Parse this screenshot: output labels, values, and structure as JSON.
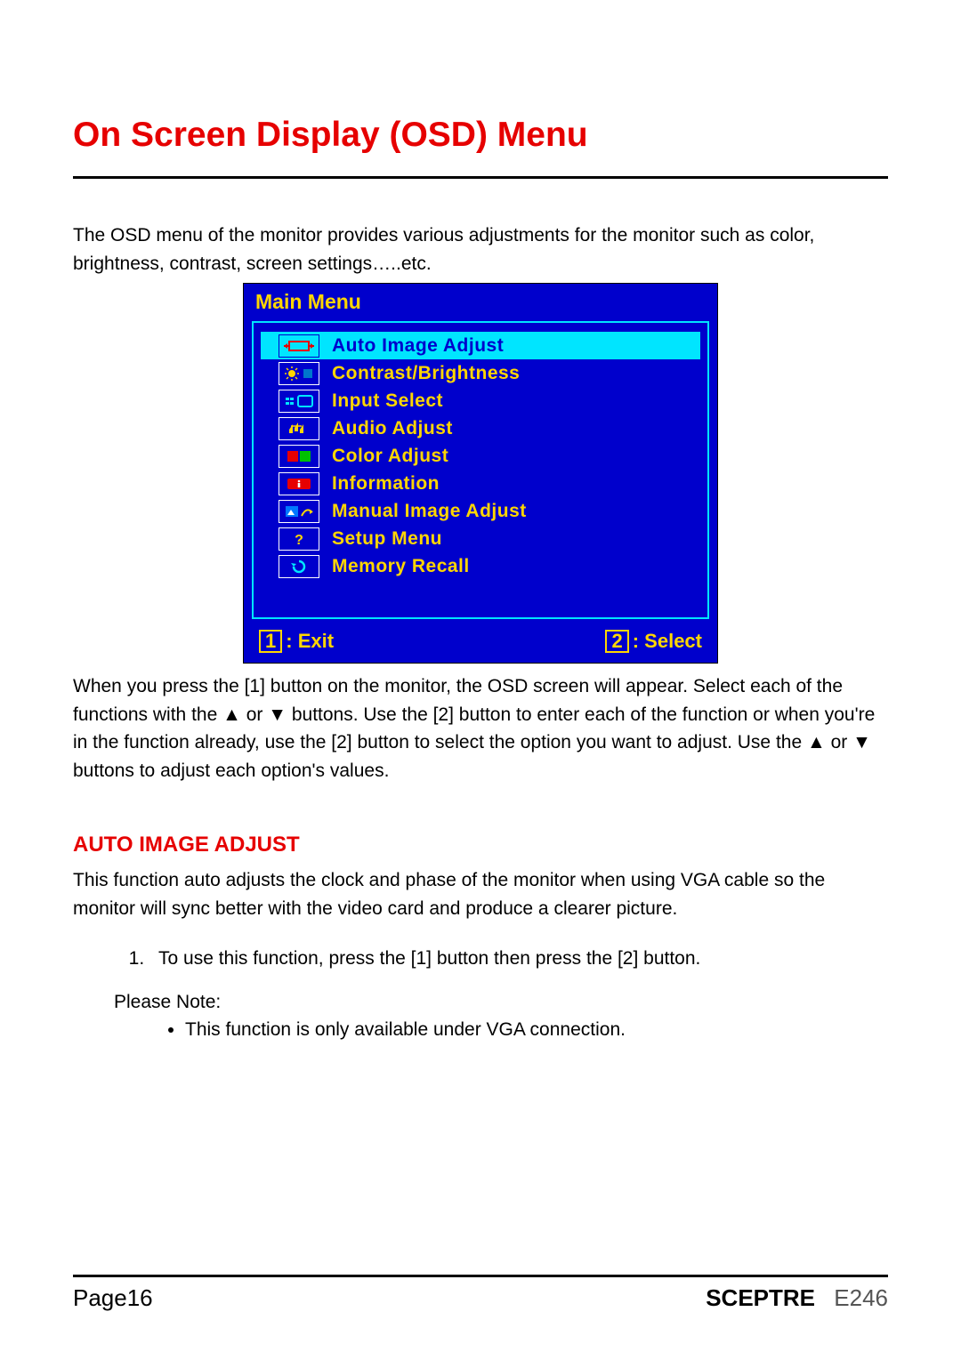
{
  "title": "On Screen Display (OSD) Menu",
  "intro": "The OSD menu of the monitor provides various adjustments for the monitor such as color, brightness, contrast, screen settings…..etc.",
  "osd": {
    "header": "Main Menu",
    "items": [
      {
        "icon": "auto-image-icon",
        "label": "Auto Image Adjust"
      },
      {
        "icon": "brightness-icon",
        "label": "Contrast/Brightness"
      },
      {
        "icon": "input-select-icon",
        "label": "Input Select"
      },
      {
        "icon": "audio-icon",
        "label": "Audio Adjust"
      },
      {
        "icon": "color-icon",
        "label": "Color Adjust"
      },
      {
        "icon": "info-icon",
        "label": "Information"
      },
      {
        "icon": "manual-image-icon",
        "label": "Manual Image Adjust"
      },
      {
        "icon": "setup-icon",
        "label": "Setup Menu"
      },
      {
        "icon": "memory-recall-icon",
        "label": "Memory Recall"
      }
    ],
    "footer": {
      "exit_key": "1",
      "exit_label": ": Exit",
      "select_key": "2",
      "select_label": ": Select"
    }
  },
  "after_osd": "When you press the [1] button on the monitor, the OSD screen will appear. Select each of the functions with the ▲ or ▼ buttons. Use the [2] button to enter each of the function or when you're in the function already, use the [2] button to select the option you want to adjust. Use the ▲ or ▼ buttons to adjust each option's values.",
  "section_heading": "AUTO IMAGE ADJUST",
  "section_body": "This function auto adjusts the clock and phase of the monitor when using VGA cable so the monitor will sync better with the video card and produce a clearer picture.",
  "step1": "To use this function, press the [1] button then press the [2] button.",
  "note_label": "Please Note:",
  "note_item": "This function is only available under VGA connection.",
  "footer": {
    "page": "Page16",
    "brand": "SCEPTRE",
    "model": "E246"
  }
}
